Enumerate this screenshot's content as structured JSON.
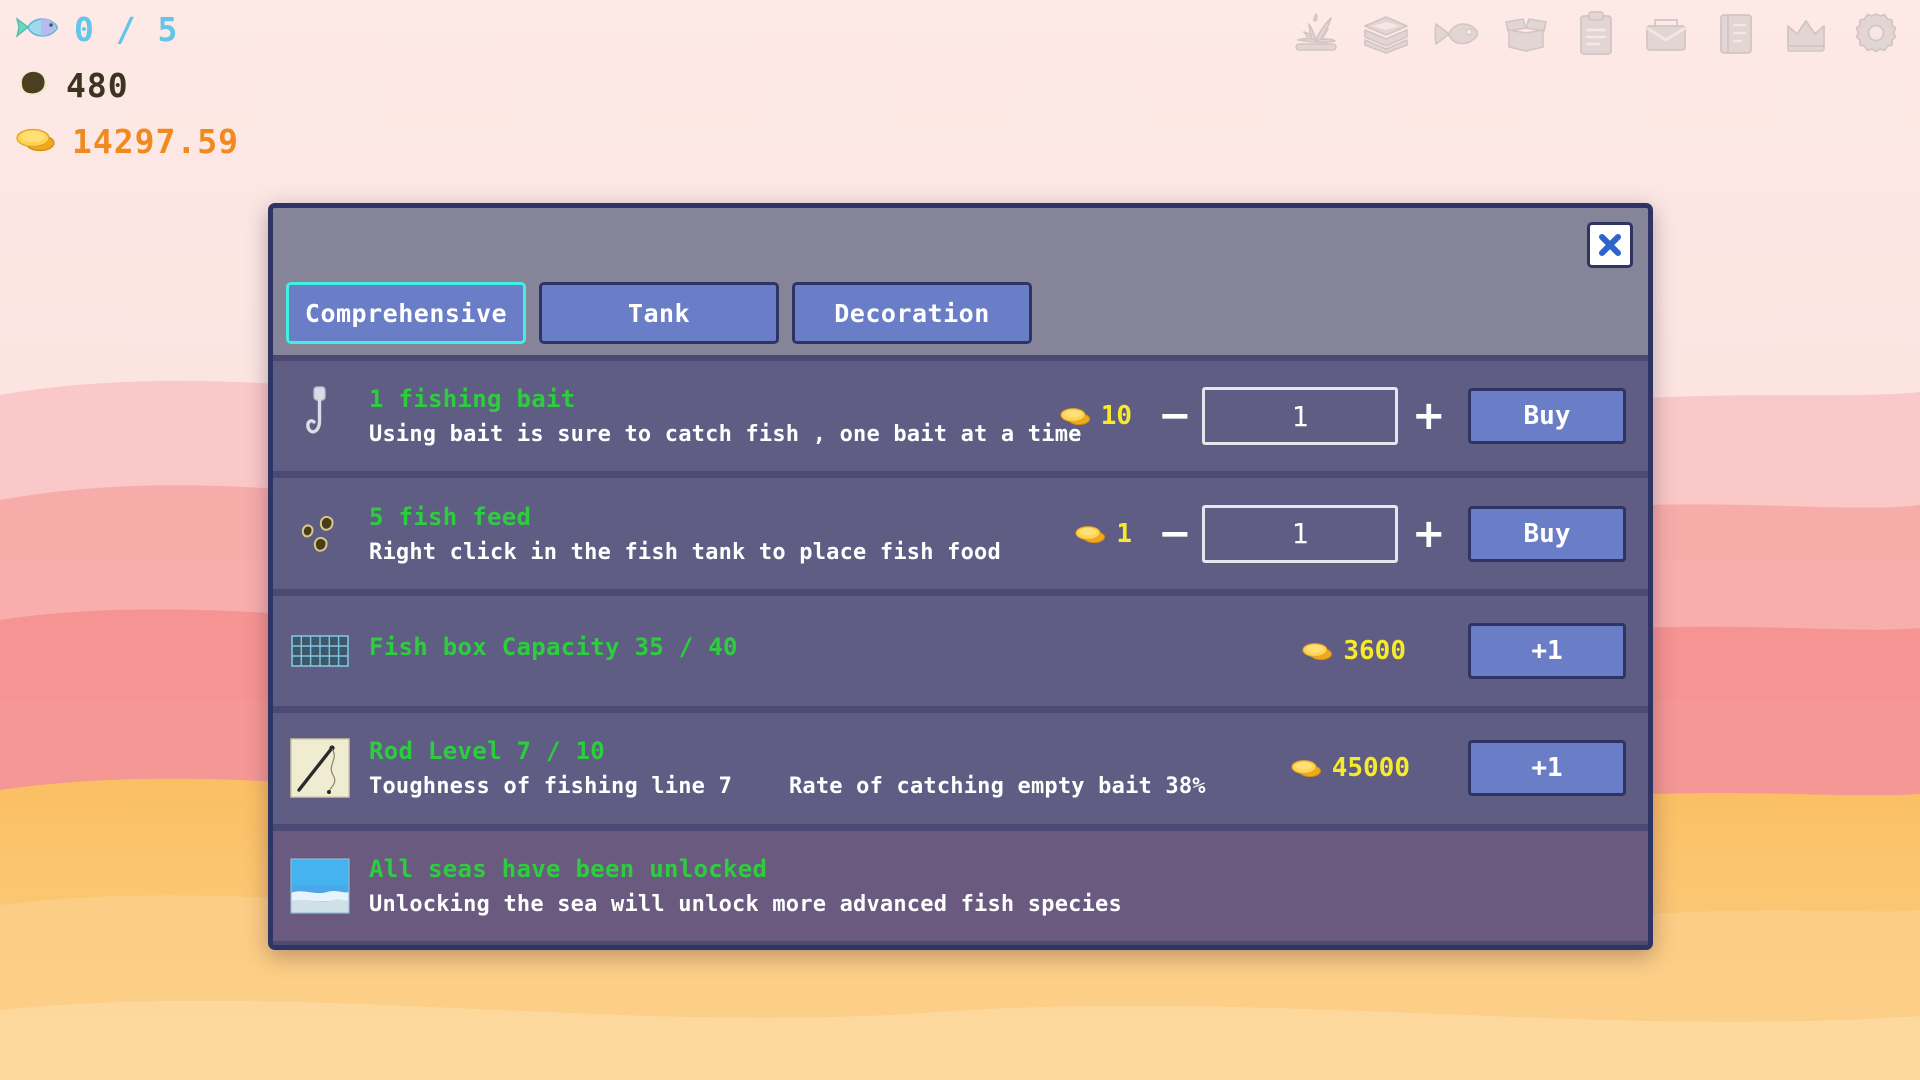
{
  "hud": {
    "fish_counter": "0 / 5",
    "pellets": "480",
    "coins": "14297.59",
    "fish_icon": "fish-icon",
    "pellet_icon": "pellet-icon",
    "coin_icon": "coin-icon"
  },
  "toolbar": {
    "icons": [
      {
        "name": "fishing-splash-icon",
        "label": "Fishing"
      },
      {
        "name": "aquarium-tank-icon",
        "label": "Tank"
      },
      {
        "name": "fish-icon",
        "label": "Fish"
      },
      {
        "name": "open-box-icon",
        "label": "Box"
      },
      {
        "name": "clipboard-icon",
        "label": "Tasks"
      },
      {
        "name": "mailbox-icon",
        "label": "Mail"
      },
      {
        "name": "book-icon",
        "label": "Encyclopedia"
      },
      {
        "name": "crown-icon",
        "label": "Ranking"
      },
      {
        "name": "gear-icon",
        "label": "Settings"
      }
    ]
  },
  "shop": {
    "close_label": "✕",
    "tabs": [
      {
        "label": "Comprehensive",
        "active": true
      },
      {
        "label": "Tank",
        "active": false
      },
      {
        "label": "Decoration",
        "active": false
      }
    ],
    "rows": [
      {
        "icon": "fishing-hook-icon",
        "title": "1 fishing bait",
        "subtitle": "Using bait is sure to catch fish , one bait at a time",
        "subtitle2": "",
        "price": "10",
        "quantity": "1",
        "minus": "−",
        "plus": "+",
        "action": "Buy"
      },
      {
        "icon": "fish-feed-pellets-icon",
        "title": "5 fish feed",
        "subtitle": "Right click in the fish tank to place fish food",
        "subtitle2": "",
        "price": "1",
        "quantity": "1",
        "minus": "−",
        "plus": "+",
        "action": "Buy"
      },
      {
        "icon": "fish-box-grid-icon",
        "title": "Fish box Capacity  35 / 40",
        "subtitle": "",
        "subtitle2": "",
        "price": "3600",
        "quantity": "",
        "minus": "",
        "plus": "",
        "action": "+1"
      },
      {
        "icon": "fishing-rod-icon",
        "title": "Rod Level  7 / 10",
        "subtitle": "Toughness of fishing line  7",
        "subtitle2": "Rate of catching empty bait  38%",
        "price": "45000",
        "quantity": "",
        "minus": "",
        "plus": "",
        "action": "+1"
      },
      {
        "icon": "sea-unlock-icon",
        "title": "All seas have been unlocked",
        "subtitle": "Unlocking the sea will unlock more advanced fish species",
        "subtitle2": "",
        "price": "",
        "quantity": "",
        "minus": "",
        "plus": "",
        "action": ""
      }
    ]
  },
  "colors": {
    "accent_cyan": "#3ef2e0",
    "title_green": "#2ecc3f",
    "price_yellow": "#f7e92b",
    "coin_orange": "#f08a1e",
    "fish_blue": "#63c5e8",
    "panel": "#5f5d84",
    "panel_header": "#868499",
    "border_dark": "#2e3463",
    "button_blue": "#6a7ec8"
  }
}
